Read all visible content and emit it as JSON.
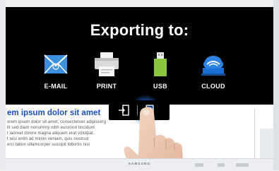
{
  "overlay": {
    "title": "Exporting to:",
    "options": [
      {
        "label": "E-MAIL",
        "icon": "email-icon",
        "color": "#3d8fe0"
      },
      {
        "label": "PRINT",
        "icon": "printer-icon",
        "color": "#e6e6e6"
      },
      {
        "label": "USB",
        "icon": "usb-icon",
        "color": "#8cc63f"
      },
      {
        "label": "CLOUD",
        "icon": "cloud-icon",
        "color": "#1a6fd1"
      }
    ]
  },
  "actionbar": {
    "buttons": [
      {
        "icon": "export-icon"
      },
      {
        "icon": "save-device-icon",
        "active": true
      }
    ]
  },
  "document": {
    "heading": "em ipsum dolor sit amet",
    "lines": [
      "orem ipsum dolor sit amet, consectetuer adipiscing",
      "lit sed diam nonummy nibh euismod tincidunt",
      "t laoreet dolore magna aliquam erat volutpat.",
      "t wisi enim ad minim veniam, quis nostrud",
      "erci tation ullamcorper suscipit lobortis nisl"
    ]
  },
  "frame": {
    "brand": "SAMSUNG"
  },
  "colors": {
    "accent": "#1a6fd1",
    "heading": "#1a4fbf",
    "overlay_bg": "#000000"
  }
}
